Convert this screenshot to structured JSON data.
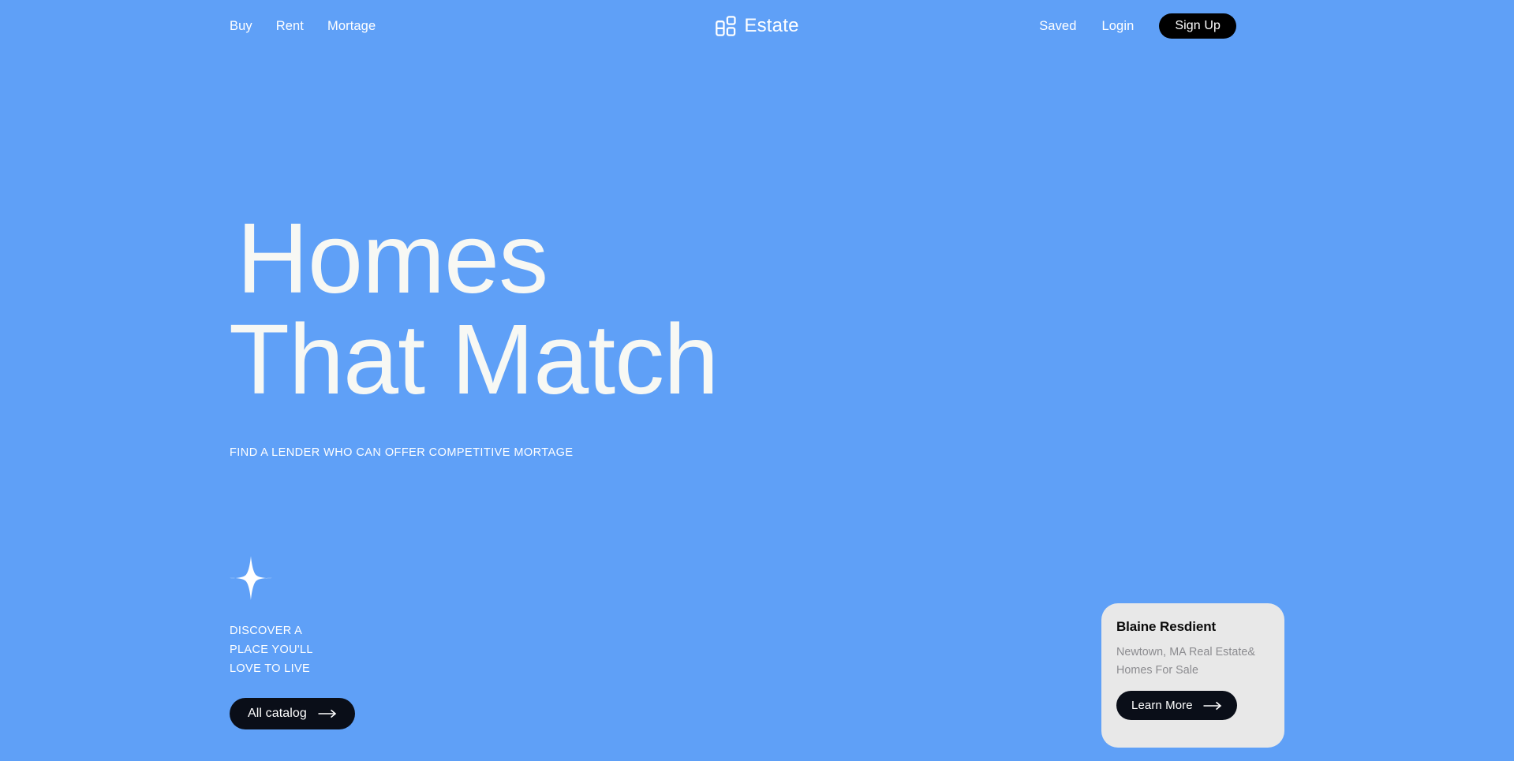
{
  "theme": {
    "background": "#5fa0f7",
    "on_background": "#ffffff",
    "headline_color": "#f7f8f4",
    "button_dark": "#0a0e18",
    "signup_button": "#000000",
    "card_background": "#e8e8e8",
    "card_title_color": "#0a0a0a",
    "card_text_color": "#8b8b8f"
  },
  "nav": {
    "links": [
      {
        "label": "Buy"
      },
      {
        "label": "Rent"
      },
      {
        "label": "Mortage"
      }
    ],
    "brand": {
      "name": "Estate",
      "icon": "grid-squares-icon"
    },
    "account": [
      {
        "label": "Saved"
      },
      {
        "label": "Login"
      }
    ],
    "signup_label": "Sign Up"
  },
  "hero": {
    "headline_line_1": "Homes",
    "headline_line_2": "That Match",
    "subhead": "FIND A LENDER WHO CAN OFFER COMPETITIVE MORTAGE"
  },
  "discover": {
    "icon": "sparkle-icon",
    "line_1": "DISCOVER A",
    "line_2": "PLACE YOU'LL",
    "line_3": "LOVE TO LIVE",
    "cta_label": "All catalog",
    "cta_icon": "arrow-right-icon"
  },
  "property_card": {
    "title": "Blaine Resdient",
    "description_line_1": "Newtown, MA Real Estate&",
    "description_line_2": "Homes For Sale",
    "cta_label": "Learn More",
    "cta_icon": "arrow-right-icon"
  }
}
